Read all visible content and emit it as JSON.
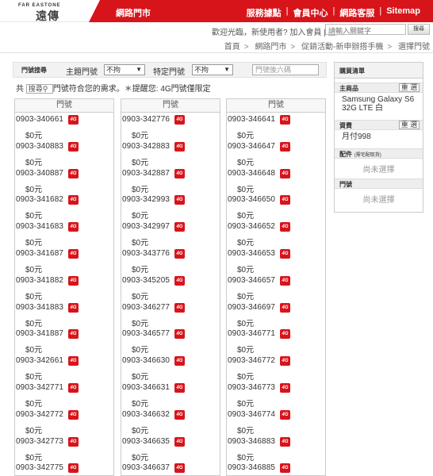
{
  "header": {
    "logo_small": "FAR EASTONE",
    "logo_main": "遠傳",
    "section_title": "網路門市",
    "links": [
      "服務據點",
      "會員中心",
      "網路客服",
      "Sitemap"
    ]
  },
  "subheader": {
    "welcome": "歡迎光臨，新使用者? 加入會員 | 登入",
    "search_placeholder": "請輸入關鍵字",
    "search_button": "搜尋"
  },
  "breadcrumb": [
    "首頁",
    "網路門市",
    "促銷活動-新申辦搭手機",
    "選擇門號"
  ],
  "filter": {
    "title": "門號搜尋",
    "theme_label": "主題門號",
    "theme_value": "不拘",
    "special_label": "特定門號",
    "special_value": "不拘",
    "number_placeholder": "門號後六碼"
  },
  "info": {
    "prefix": "共",
    "mini_search": "搜尋",
    "text": "門號符合您的需求。＊提醒您: 4G門號僅限定"
  },
  "column_header": "門號",
  "badge_label": "4G",
  "columns": [
    [
      {
        "number": "0903-340661",
        "price": "$0元"
      },
      {
        "number": "0903-340883",
        "price": "$0元"
      },
      {
        "number": "0903-340887",
        "price": "$0元"
      },
      {
        "number": "0903-341682",
        "price": "$0元"
      },
      {
        "number": "0903-341683",
        "price": "$0元"
      },
      {
        "number": "0903-341687",
        "price": "$0元"
      },
      {
        "number": "0903-341882",
        "price": "$0元"
      },
      {
        "number": "0903-341883",
        "price": "$0元"
      },
      {
        "number": "0903-341887",
        "price": "$0元"
      },
      {
        "number": "0903-342661",
        "price": "$0元"
      },
      {
        "number": "0903-342771",
        "price": "$0元"
      },
      {
        "number": "0903-342772",
        "price": "$0元"
      },
      {
        "number": "0903-342773",
        "price": "$0元"
      },
      {
        "number": "0903-342775",
        "price": "$0元"
      }
    ],
    [
      {
        "number": "0903-342776",
        "price": "$0元"
      },
      {
        "number": "0903-342883",
        "price": "$0元"
      },
      {
        "number": "0903-342887",
        "price": "$0元"
      },
      {
        "number": "0903-342993",
        "price": "$0元"
      },
      {
        "number": "0903-342997",
        "price": "$0元"
      },
      {
        "number": "0903-343776",
        "price": "$0元"
      },
      {
        "number": "0903-345205",
        "price": "$0元"
      },
      {
        "number": "0903-346277",
        "price": "$0元"
      },
      {
        "number": "0903-346577",
        "price": "$0元"
      },
      {
        "number": "0903-346630",
        "price": "$0元"
      },
      {
        "number": "0903-346631",
        "price": "$0元"
      },
      {
        "number": "0903-346632",
        "price": "$0元"
      },
      {
        "number": "0903-346635",
        "price": "$0元"
      },
      {
        "number": "0903-346637",
        "price": "$0元"
      }
    ],
    [
      {
        "number": "0903-346641",
        "price": "$0元"
      },
      {
        "number": "0903-346647",
        "price": "$0元"
      },
      {
        "number": "0903-346648",
        "price": "$0元"
      },
      {
        "number": "0903-346650",
        "price": "$0元"
      },
      {
        "number": "0903-346652",
        "price": "$0元"
      },
      {
        "number": "0903-346653",
        "price": "$0元"
      },
      {
        "number": "0903-346657",
        "price": "$0元"
      },
      {
        "number": "0903-346697",
        "price": "$0元"
      },
      {
        "number": "0903-346771",
        "price": "$0元"
      },
      {
        "number": "0903-346772",
        "price": "$0元"
      },
      {
        "number": "0903-346773",
        "price": "$0元"
      },
      {
        "number": "0903-346774",
        "price": "$0元"
      },
      {
        "number": "0903-346883",
        "price": "$0元"
      },
      {
        "number": "0903-346885",
        "price": "$0元"
      }
    ]
  ],
  "cart": {
    "title": "購買清單",
    "product_label": "主商品",
    "product_button": "重 選",
    "product_value": "Samsung Galaxy S6 32G LTE 白",
    "plan_label": "資費",
    "plan_button": "重 選",
    "plan_value": "月付998",
    "accessory_label": "配件",
    "accessory_note": "(需宅配取貨)",
    "accessory_value": "尚未選擇",
    "number_label": "門號",
    "number_value": "尚未選擇"
  },
  "colors": {
    "brand_red": "#d8141b",
    "panel_gray": "#f2f2f2",
    "border": "#cccccc"
  }
}
